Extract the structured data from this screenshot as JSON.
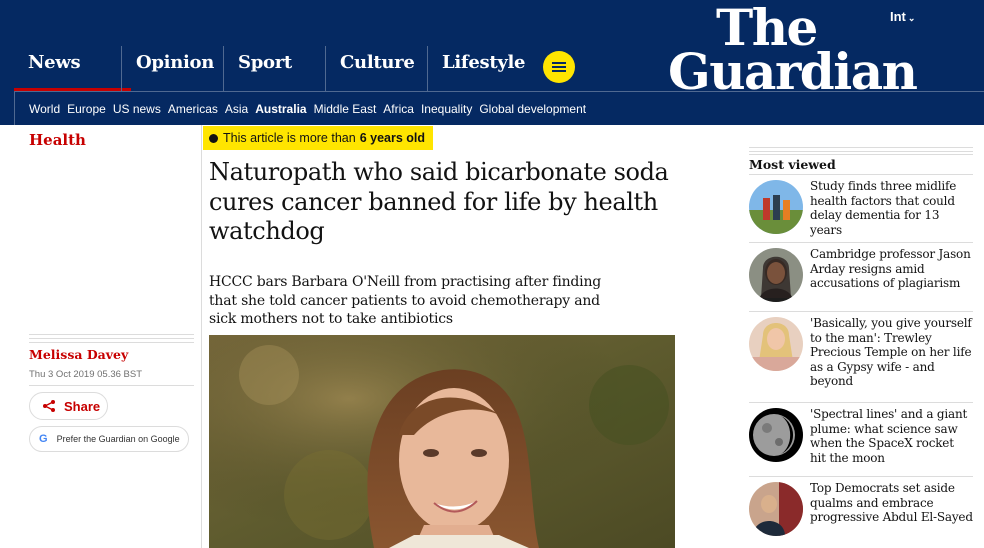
{
  "header": {
    "edition": "Int",
    "logo_line1": "The",
    "logo_line2": "Guardian",
    "pillars": [
      "News",
      "Opinion",
      "Sport",
      "Culture",
      "Lifestyle"
    ],
    "subnav": [
      "World",
      "Europe",
      "US news",
      "Americas",
      "Asia",
      "Australia",
      "Middle East",
      "Africa",
      "Inequality",
      "Global development"
    ],
    "active_subnav": "Australia"
  },
  "article": {
    "section": "Health",
    "age_prefix": "This article is more than",
    "age_value": "6 years old",
    "headline": "Naturopath who said bicarbonate soda cures cancer banned for life by health watchdog",
    "standfirst": "HCCC bars Barbara O'Neill from practising after finding that she told cancer patients to avoid chemotherapy and sick mothers not to take antibiotics",
    "author": "Melissa Davey",
    "dateline": "Thu 3 Oct 2019 05.36 BST",
    "share_label": "Share",
    "prefer_label": "Prefer the Guardian on Google",
    "prefer_icon_glyph": "G"
  },
  "most_viewed": {
    "title": "Most viewed",
    "items": [
      {
        "headline": "Study finds three midlife health factors that could delay dementia for 13 years"
      },
      {
        "headline": "Cambridge professor Jason Arday resigns amid accusations of plagiarism"
      },
      {
        "headline": "'Basically, you give yourself to the man': Trewley Precious Temple on her life as a Gypsy wife - and beyond"
      },
      {
        "headline": "'Spectral lines' and a giant plume: what science saw when the SpaceX rocket hit the moon"
      },
      {
        "headline": "Top Democrats set aside qualms and embrace progressive Abdul El-Sayed"
      }
    ]
  },
  "colors": {
    "brand_blue": "#052962",
    "news_red": "#c70000",
    "highlight_yellow": "#ffe500"
  },
  "icons": {
    "menu": "hamburger-icon",
    "share": "share-icon",
    "google": "google-icon",
    "clock": "clock-icon",
    "edition_chevron": "chevron-down-icon"
  }
}
